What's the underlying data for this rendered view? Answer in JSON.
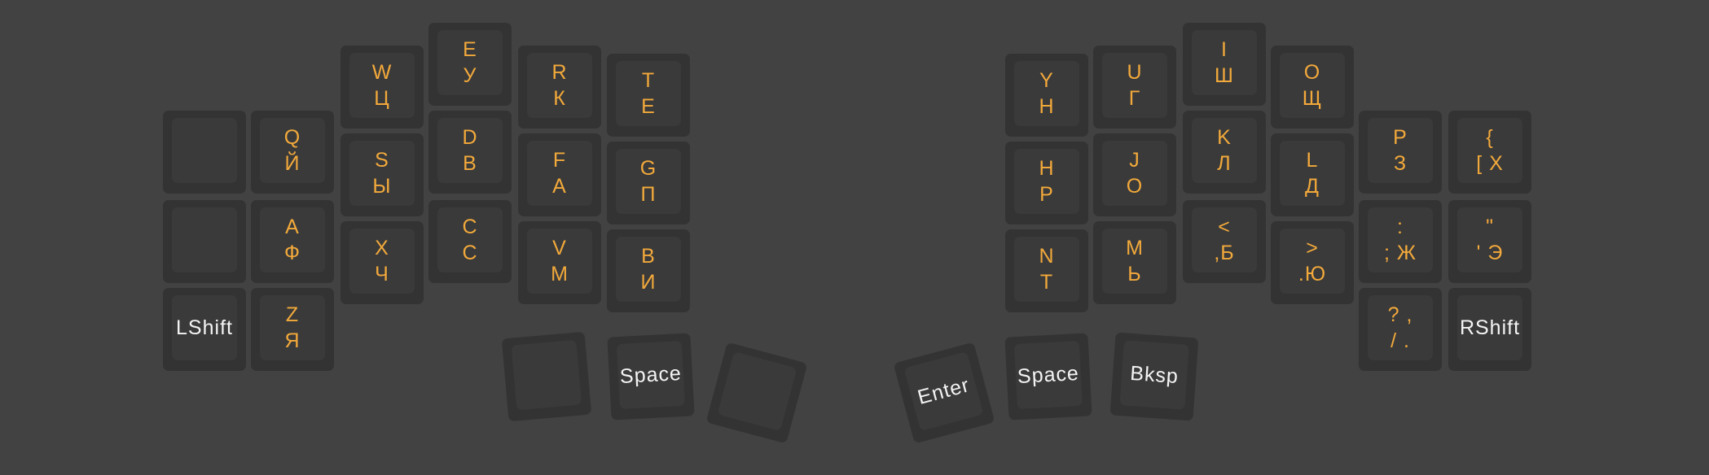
{
  "colors": {
    "background": "#424242",
    "key": "#333333",
    "keycap": "#3a3a3a",
    "legend": "#f2a93b",
    "modifier_legend": "#f4f4f4"
  },
  "left_hand": [
    {
      "id": "l-blank-top",
      "lines": []
    },
    {
      "id": "l-q",
      "lines": [
        "Q",
        "Й"
      ]
    },
    {
      "id": "l-w",
      "lines": [
        "W",
        "Ц"
      ]
    },
    {
      "id": "l-e",
      "lines": [
        "E",
        "У"
      ]
    },
    {
      "id": "l-r",
      "lines": [
        "R",
        "К"
      ]
    },
    {
      "id": "l-t",
      "lines": [
        "T",
        "Е"
      ]
    },
    {
      "id": "l-blank-mid",
      "lines": []
    },
    {
      "id": "l-a",
      "lines": [
        "A",
        "Ф"
      ]
    },
    {
      "id": "l-s",
      "lines": [
        "S",
        "Ы"
      ]
    },
    {
      "id": "l-d",
      "lines": [
        "D",
        "В"
      ]
    },
    {
      "id": "l-f",
      "lines": [
        "F",
        "А"
      ]
    },
    {
      "id": "l-g",
      "lines": [
        "G",
        "П"
      ]
    },
    {
      "id": "l-lshift",
      "lines": [
        "LShift"
      ]
    },
    {
      "id": "l-z",
      "lines": [
        "Z",
        "Я"
      ]
    },
    {
      "id": "l-x",
      "lines": [
        "X",
        "Ч"
      ]
    },
    {
      "id": "l-c",
      "lines": [
        "C",
        "С"
      ]
    },
    {
      "id": "l-v",
      "lines": [
        "V",
        "М"
      ]
    },
    {
      "id": "l-b",
      "lines": [
        "B",
        "И"
      ]
    }
  ],
  "right_hand": [
    {
      "id": "r-y",
      "lines": [
        "Y",
        "Н"
      ]
    },
    {
      "id": "r-u",
      "lines": [
        "U",
        "Г"
      ]
    },
    {
      "id": "r-i",
      "lines": [
        "I",
        "Ш"
      ]
    },
    {
      "id": "r-o",
      "lines": [
        "O",
        "Щ"
      ]
    },
    {
      "id": "r-p",
      "lines": [
        "P",
        "З"
      ]
    },
    {
      "id": "r-bracket",
      "lines": [
        "{",
        "[ Х"
      ]
    },
    {
      "id": "r-h",
      "lines": [
        "H",
        "Р"
      ]
    },
    {
      "id": "r-j",
      "lines": [
        "J",
        "О"
      ]
    },
    {
      "id": "r-k",
      "lines": [
        "K",
        "Л"
      ]
    },
    {
      "id": "r-l",
      "lines": [
        "L",
        "Д"
      ]
    },
    {
      "id": "r-semicolon",
      "lines": [
        ":",
        "; Ж"
      ]
    },
    {
      "id": "r-quote",
      "lines": [
        "\"",
        "' Э"
      ]
    },
    {
      "id": "r-n",
      "lines": [
        "N",
        "Т"
      ]
    },
    {
      "id": "r-m",
      "lines": [
        "M",
        "Ь"
      ]
    },
    {
      "id": "r-comma",
      "lines": [
        "<",
        ",Б"
      ]
    },
    {
      "id": "r-period",
      "lines": [
        ">",
        ".Ю"
      ]
    },
    {
      "id": "r-slash",
      "lines": [
        "? ,",
        "/ ."
      ]
    },
    {
      "id": "r-rshift",
      "lines": [
        "RShift"
      ]
    }
  ],
  "thumb_left": [
    {
      "id": "tl-blank-1",
      "lines": []
    },
    {
      "id": "tl-space",
      "lines": [
        "Space"
      ]
    },
    {
      "id": "tl-blank-2",
      "lines": []
    }
  ],
  "thumb_right": [
    {
      "id": "tr-enter",
      "lines": [
        "Enter"
      ]
    },
    {
      "id": "tr-space",
      "lines": [
        "Space"
      ]
    },
    {
      "id": "tr-bksp",
      "lines": [
        "Bksp"
      ]
    }
  ]
}
